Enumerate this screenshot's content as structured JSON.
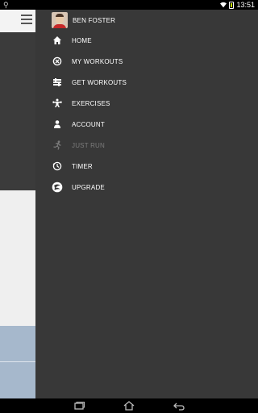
{
  "status_bar": {
    "time": "13:51"
  },
  "drawer": {
    "profile": {
      "name": "BEN FOSTER"
    },
    "items": [
      {
        "label": "HOME",
        "icon": "home-icon",
        "disabled": false
      },
      {
        "label": "MY WORKOUTS",
        "icon": "my-workouts-icon",
        "disabled": false
      },
      {
        "label": "GET WORKOUTS",
        "icon": "get-workouts-icon",
        "disabled": false
      },
      {
        "label": "EXERCISES",
        "icon": "exercises-icon",
        "disabled": false
      },
      {
        "label": "ACCOUNT",
        "icon": "account-icon",
        "disabled": false
      },
      {
        "label": "JUST RUN",
        "icon": "run-icon",
        "disabled": true
      },
      {
        "label": "TIMER",
        "icon": "timer-icon",
        "disabled": false
      },
      {
        "label": "UPGRADE",
        "icon": "upgrade-icon",
        "disabled": false
      }
    ]
  },
  "colors": {
    "drawer_bg": "#383838",
    "disabled_text": "#7b7b7b",
    "accent_blue": "#a6b8cc"
  }
}
